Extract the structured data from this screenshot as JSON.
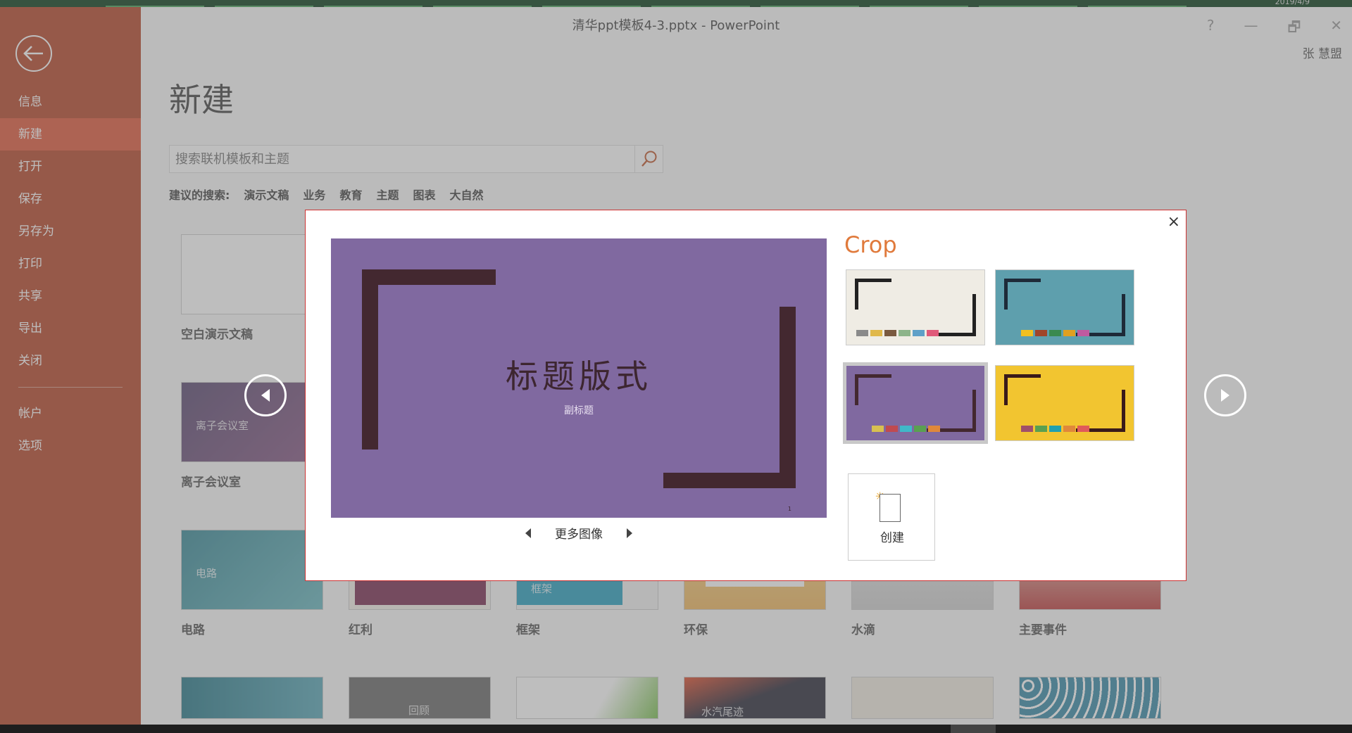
{
  "window": {
    "title": "清华ppt模板4-3.pptx - PowerPoint",
    "controls": [
      "?",
      "—",
      "🗗",
      "✕"
    ],
    "user": "张 慧盟",
    "taskbar_date": "2019/4/9"
  },
  "sidebar": {
    "back_icon": "back-arrow-icon",
    "items": [
      {
        "label": "信息"
      },
      {
        "label": "新建",
        "active": true
      },
      {
        "label": "打开"
      },
      {
        "label": "保存"
      },
      {
        "label": "另存为"
      },
      {
        "label": "打印"
      },
      {
        "label": "共享"
      },
      {
        "label": "导出"
      },
      {
        "label": "关闭"
      }
    ],
    "items_bottom": [
      {
        "label": "帐户"
      },
      {
        "label": "选项"
      }
    ]
  },
  "main": {
    "title": "新建",
    "search": {
      "placeholder": "搜索联机模板和主题"
    },
    "suggested": {
      "label": "建议的搜索:",
      "terms": [
        "演示文稿",
        "业务",
        "教育",
        "主题",
        "图表",
        "大自然"
      ]
    },
    "templates_row1": [
      {
        "name": "空白演示文稿"
      },
      {
        "name": "离子会议室",
        "thumb_text": "离子会议室"
      }
    ],
    "templates_row2": [
      {
        "name": "电路",
        "thumb_text": "电路"
      },
      {
        "name": "红利"
      },
      {
        "name": "框架",
        "thumb_text": "框架"
      },
      {
        "name": "环保"
      },
      {
        "name": "水滴"
      },
      {
        "name": "主要事件"
      }
    ],
    "templates_row3_thumb_text": [
      "回顾",
      "水汽尾迹"
    ]
  },
  "dialog": {
    "close": "×",
    "theme_name": "Crop",
    "preview": {
      "title": "标题版式",
      "subtitle": "副标题",
      "page_number": "1"
    },
    "more_images": "更多图像",
    "create": "创建",
    "variants": [
      {
        "bg": "#efece4",
        "frame": "#222222",
        "swatches": [
          "#8a8a8a",
          "#e0b84a",
          "#7a5a40",
          "#8db48a",
          "#5fa0c8",
          "#e05a7a"
        ]
      },
      {
        "bg": "#5e9fad",
        "frame": "#1e2a38",
        "swatches": [
          "#f0c020",
          "#a0452a",
          "#3a8a50",
          "#e0a020",
          "#c05aa0"
        ]
      },
      {
        "bg": "#8069a0",
        "frame": "#432830",
        "swatches": [
          "#d8c050",
          "#c04a50",
          "#40b8c8",
          "#5aa050",
          "#e0883a"
        ],
        "selected": true
      },
      {
        "bg": "#f2c530",
        "frame": "#3a1a1a",
        "swatches": [
          "#a0506a",
          "#5aa050",
          "#20a0b0",
          "#e0883a",
          "#e05a5a"
        ]
      }
    ]
  }
}
